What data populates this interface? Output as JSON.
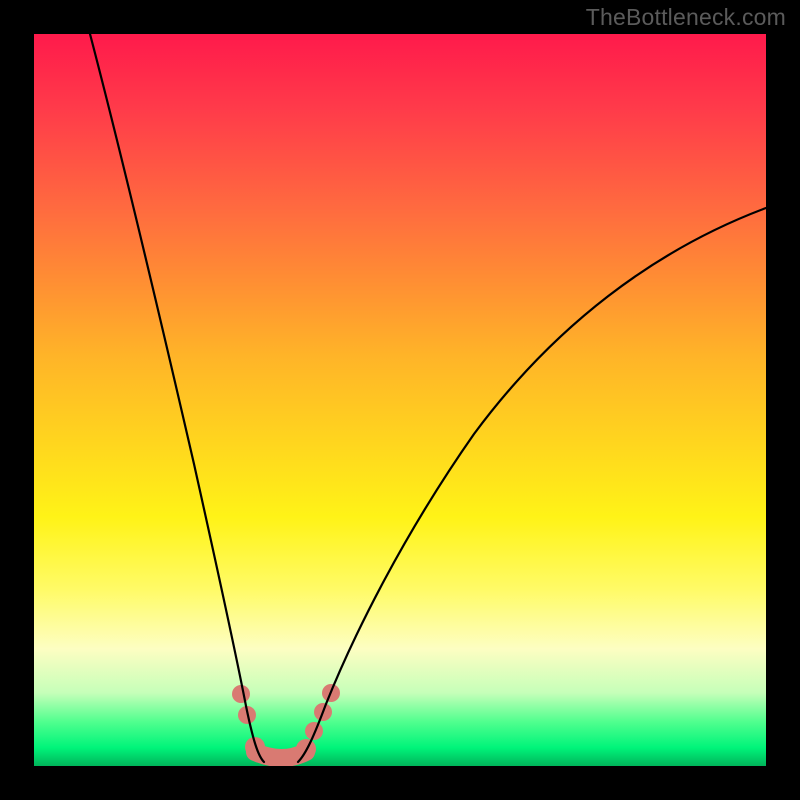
{
  "watermark": "TheBottleneck.com",
  "colors": {
    "frame": "#000000",
    "curve": "#000000",
    "marker": "#d97a72"
  },
  "chart_data": {
    "type": "line",
    "title": "",
    "xlabel": "",
    "ylabel": "",
    "xlim": [
      0,
      100
    ],
    "ylim": [
      0,
      100
    ],
    "grid": false,
    "series": [
      {
        "name": "left-curve",
        "x": [
          8,
          12,
          16,
          20,
          22,
          24,
          26,
          28,
          29,
          30,
          30.5
        ],
        "y": [
          100,
          85,
          69,
          50,
          40,
          29,
          19,
          10,
          5,
          1.5,
          0.5
        ]
      },
      {
        "name": "right-curve",
        "x": [
          36.5,
          37.5,
          39,
          42,
          46,
          52,
          60,
          70,
          82,
          94,
          100
        ],
        "y": [
          0.5,
          1.5,
          4,
          10,
          18,
          28,
          40,
          52,
          63,
          72,
          76
        ]
      },
      {
        "name": "valley-floor",
        "x": [
          30.5,
          32,
          34,
          35.5,
          36.5
        ],
        "y": [
          0.5,
          0.2,
          0.2,
          0.2,
          0.5
        ]
      }
    ],
    "markers": {
      "name": "highlight-dots",
      "color": "#d97a72",
      "points": [
        {
          "series": "left-curve",
          "x": 28.2,
          "y": 9.2
        },
        {
          "series": "left-curve",
          "x": 28.9,
          "y": 6.2
        },
        {
          "series": "left-curve",
          "x": 30.0,
          "y": 2.0
        },
        {
          "series": "right-curve",
          "x": 36.8,
          "y": 1.8
        },
        {
          "series": "right-curve",
          "x": 38.0,
          "y": 4.2
        },
        {
          "series": "right-curve",
          "x": 39.3,
          "y": 6.8
        },
        {
          "series": "right-curve",
          "x": 40.3,
          "y": 9.2
        }
      ]
    },
    "gradient_bands": [
      {
        "y": 100,
        "color": "#ff1a4b"
      },
      {
        "y": 66,
        "color": "#ff8f33"
      },
      {
        "y": 34,
        "color": "#fff317"
      },
      {
        "y": 10,
        "color": "#c6ffb9"
      },
      {
        "y": 0,
        "color": "#00b45a"
      }
    ]
  }
}
